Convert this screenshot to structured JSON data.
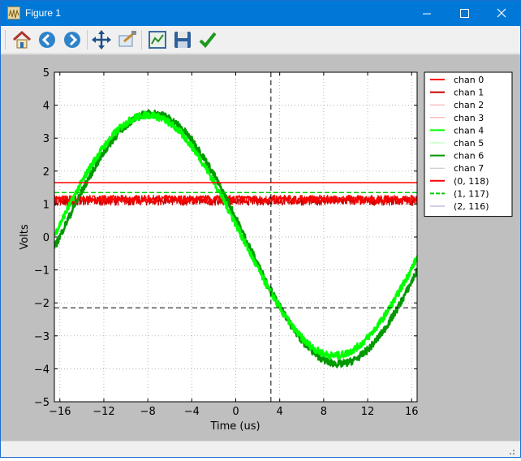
{
  "window": {
    "title": "Figure 1"
  },
  "toolbar": {
    "buttons": [
      {
        "name": "home-icon",
        "label": "Home"
      },
      {
        "name": "back-icon",
        "label": "Back"
      },
      {
        "name": "forward-icon",
        "label": "Forward"
      },
      {
        "name": "pan-icon",
        "label": "Pan"
      },
      {
        "name": "zoom-icon",
        "label": "Zoom"
      },
      {
        "name": "subplots-icon",
        "label": "Subplots"
      },
      {
        "name": "save-icon",
        "label": "Save"
      },
      {
        "name": "check-icon",
        "label": "Edit"
      }
    ]
  },
  "colors": {
    "titlebar": "#0078d7",
    "canvas": "#bfbfbf",
    "red_trace": "#ff0000",
    "dark_red_trace": "#cc0000",
    "bright_green": "#00ff00",
    "dark_green": "#009900"
  },
  "chart_data": {
    "type": "line",
    "title": "",
    "xlabel": "Time (us)",
    "ylabel": "Volts",
    "xlim": [
      -16.5,
      16.5
    ],
    "ylim": [
      -5,
      5
    ],
    "xticks": [
      -16,
      -12,
      -8,
      -4,
      0,
      4,
      8,
      12,
      16
    ],
    "yticks": [
      5,
      4,
      3,
      2,
      1,
      0,
      -1,
      -2,
      -3,
      -4,
      -5
    ],
    "xtick_labels": [
      "−16",
      "−12",
      "−8",
      "−4",
      "0",
      "4",
      "8",
      "12",
      "16"
    ],
    "ytick_labels": [
      "5",
      "4",
      "3",
      "2",
      "1",
      "0",
      "−1",
      "−2",
      "−3",
      "−4",
      "−5"
    ],
    "grid": true,
    "legend_placement": "outside upper right",
    "cursor": {
      "x": 3.2,
      "y": -2.15
    },
    "series": [
      {
        "name": "chan 0",
        "color": "#ff0000",
        "kind": "noisy-dc",
        "level": 1.15,
        "noise": 0.12
      },
      {
        "name": "chan 1",
        "color": "#cc0000",
        "kind": "noisy-dc",
        "level": 1.1,
        "noise": 0.14
      },
      {
        "name": "chan 2",
        "color": "#f4a0a0",
        "kind": "hidden"
      },
      {
        "name": "chan 3",
        "color": "#f4a0a0",
        "kind": "hidden"
      },
      {
        "name": "chan 4",
        "color": "#00ff00",
        "kind": "sine",
        "amplitude": 3.65,
        "offset": 0.05,
        "period": 34,
        "peak_at": -8.0
      },
      {
        "name": "chan 5",
        "color": "#aaffaa",
        "kind": "hidden"
      },
      {
        "name": "chan 6",
        "color": "#009900",
        "kind": "sine",
        "amplitude": 3.8,
        "offset": -0.05,
        "period": 34,
        "peak_at": -7.6
      },
      {
        "name": "chan 7",
        "color": "#c0c0c0",
        "kind": "hidden"
      },
      {
        "name": "(0, 118)",
        "color": "#ff0000",
        "kind": "hline",
        "level": 1.65
      },
      {
        "name": "(1, 117)",
        "color": "#00cc00",
        "kind": "hline",
        "level": 1.35,
        "dash": true
      },
      {
        "name": "(2, 116)",
        "color": "#a0a0d0",
        "kind": "hidden"
      }
    ]
  }
}
